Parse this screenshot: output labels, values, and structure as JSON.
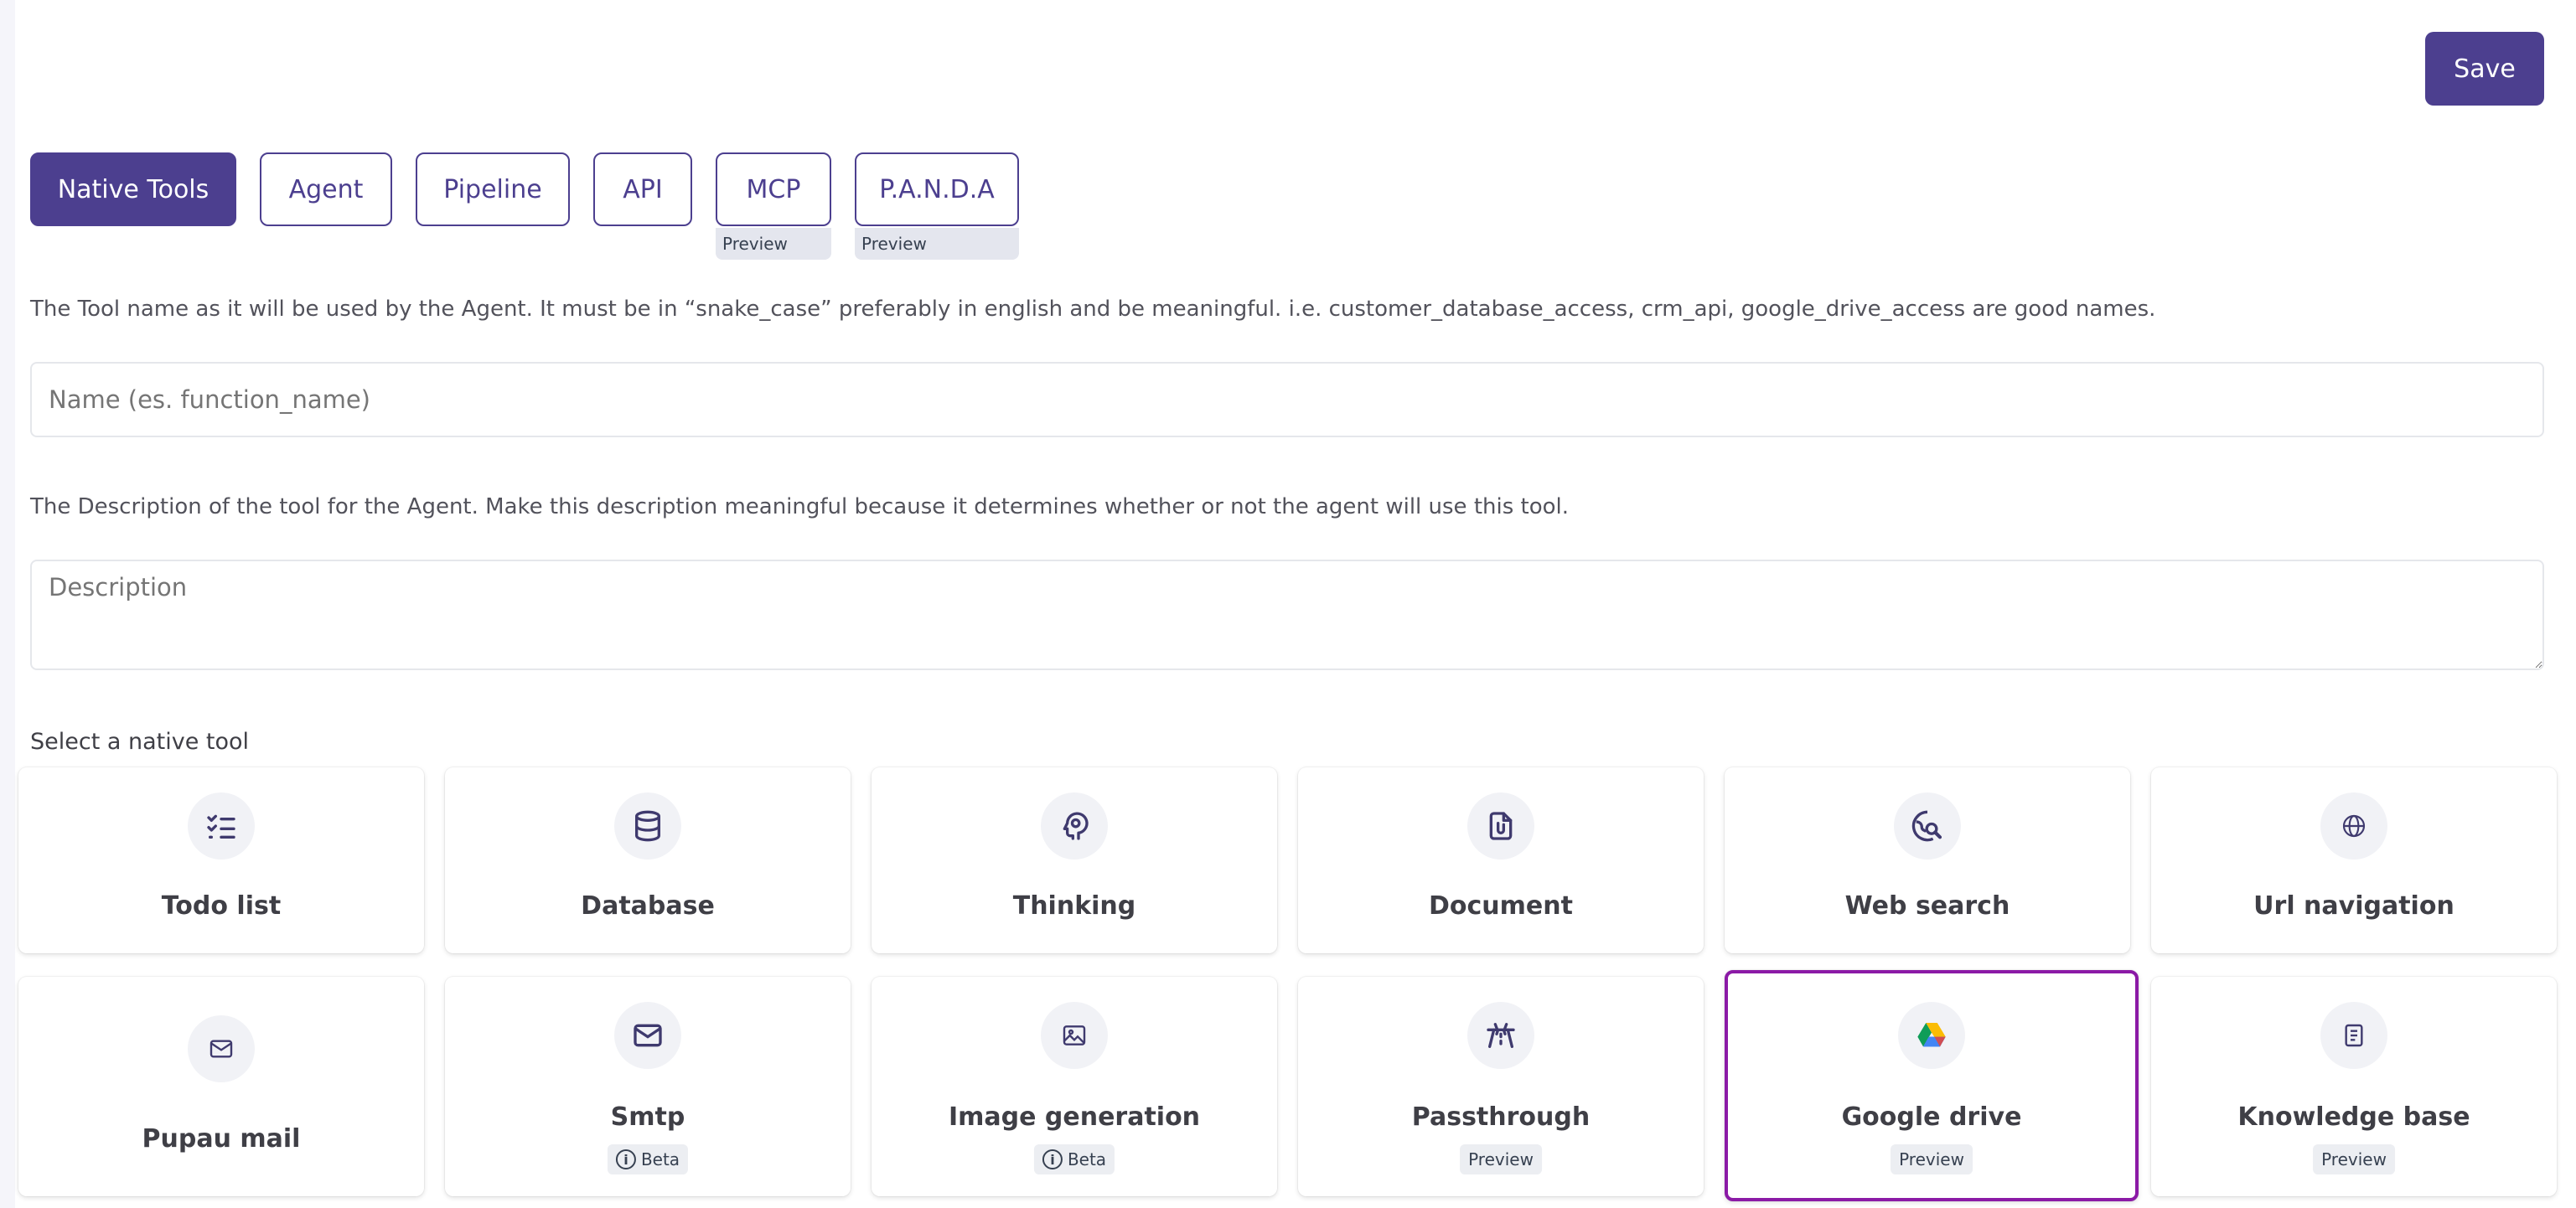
{
  "toolbar": {
    "save_label": "Save"
  },
  "tabs": [
    {
      "label": "Native Tools",
      "active": true
    },
    {
      "label": "Agent",
      "active": false
    },
    {
      "label": "Pipeline",
      "active": false
    },
    {
      "label": "API",
      "active": false
    },
    {
      "label": "MCP",
      "active": false,
      "badge": "Preview"
    },
    {
      "label": "P.A.N.D.A",
      "active": false,
      "badge": "Preview"
    }
  ],
  "form": {
    "name_help": "The Tool name as it will be used by the Agent. It must be in “snake_case” preferably in english and be meaningful. i.e. customer_database_access, crm_api, google_drive_access are good names.",
    "name_placeholder": "Name (es. function_name)",
    "name_value": "",
    "description_help": "The Description of the tool for the Agent. Make this description meaningful because it determines whether or not the agent will use this tool.",
    "description_placeholder": "Description",
    "description_value": ""
  },
  "native_tools": {
    "label": "Select a native tool",
    "items": [
      {
        "title": "Todo list",
        "icon": "checklist-icon"
      },
      {
        "title": "Database",
        "icon": "database-icon"
      },
      {
        "title": "Thinking",
        "icon": "brain-head-icon"
      },
      {
        "title": "Document",
        "icon": "document-clip-icon"
      },
      {
        "title": "Web search",
        "icon": "globe-search-icon"
      },
      {
        "title": "Url navigation",
        "icon": "globe-icon"
      },
      {
        "title": "Pupau mail",
        "icon": "mail-icon"
      },
      {
        "title": "Smtp",
        "icon": "envelope-icon",
        "badge": "Beta"
      },
      {
        "title": "Image generation",
        "icon": "image-icon",
        "badge": "Beta"
      },
      {
        "title": "Passthrough",
        "icon": "passthrough-icon",
        "badge": "Preview"
      },
      {
        "title": "Google drive",
        "icon": "google-drive-icon",
        "badge": "Preview",
        "selected": true
      },
      {
        "title": "Knowledge base",
        "icon": "book-icon",
        "badge": "Preview"
      }
    ]
  },
  "colors": {
    "primary": "#4c3f8f",
    "selected_border": "#8b1aa6",
    "badge_bg": "#e4e6ee"
  }
}
